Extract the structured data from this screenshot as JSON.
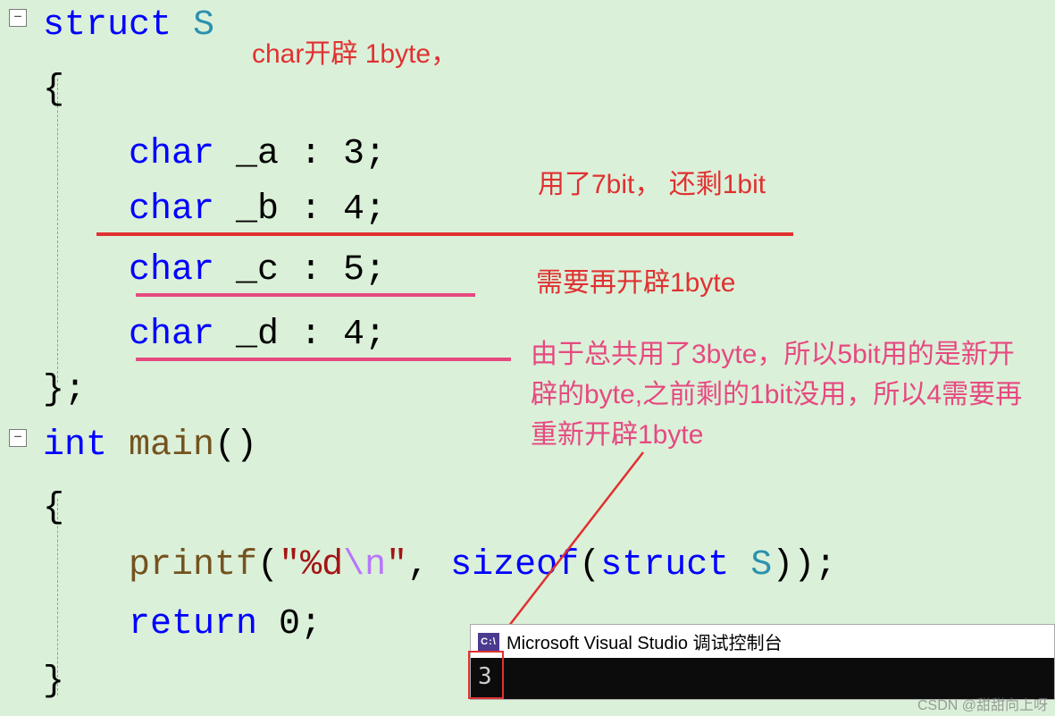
{
  "code": {
    "l1": {
      "kw": "struct",
      "ty": " S"
    },
    "l2": "{",
    "l3": {
      "indent": "    ",
      "kw": "char",
      "rest": " _a : 3;"
    },
    "l4": {
      "indent": "    ",
      "kw": "char",
      "rest": " _b : 4;"
    },
    "l5": {
      "indent": "    ",
      "kw": "char",
      "rest": " _c : 5;"
    },
    "l6": {
      "indent": "    ",
      "kw": "char",
      "rest": " _d : 4;"
    },
    "l7": "};",
    "l8": {
      "kw": "int",
      "fn": " main",
      "rest": "()"
    },
    "l9": "{",
    "l10": {
      "indent": "    ",
      "fn": "printf",
      "p1": "(",
      "q1": "\"",
      "str": "%d",
      "esc": "\\n",
      "q2": "\"",
      "c": ", ",
      "op": "sizeof",
      "p2": "(",
      "kw": "struct",
      "ty": " S",
      "p3": "));"
    },
    "l11": {
      "indent": "    ",
      "kw": "return",
      "rest": " 0;"
    },
    "l12": "}"
  },
  "annotations": {
    "a1": "char开辟 1byte，",
    "a2": "用了7bit， 还剩1bit",
    "a3": "需要再开辟1byte",
    "a4": "由于总共用了3byte，所以5bit用的是新开辟的byte,之前剩的1bit没用，所以4需要再重新开辟1byte"
  },
  "console": {
    "title": "Microsoft Visual Studio 调试控制台",
    "output": "3"
  },
  "watermark": "CSDN @甜甜向上呀"
}
